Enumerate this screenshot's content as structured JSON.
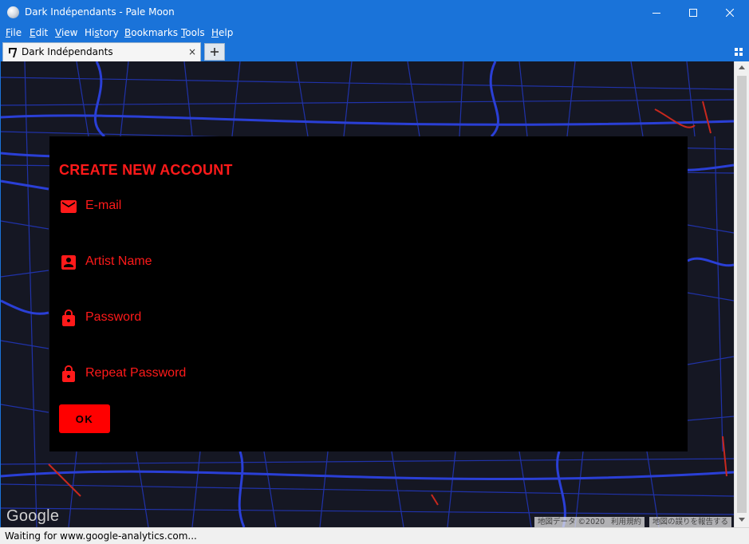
{
  "window": {
    "title": "Dark Indépendants - Pale Moon"
  },
  "menubar": {
    "items": [
      {
        "label": "File",
        "accel": "F",
        "rest": "ile"
      },
      {
        "label": "Edit",
        "accel": "E",
        "rest": "dit"
      },
      {
        "label": "View",
        "accel": "V",
        "rest": "iew"
      },
      {
        "label": "History",
        "accel": "s",
        "pre": "Hi",
        "rest": "tory"
      },
      {
        "label": "Bookmarks",
        "accel": "B",
        "rest": "ookmarks"
      },
      {
        "label": "Tools",
        "accel": "T",
        "rest": "ools"
      },
      {
        "label": "Help",
        "accel": "H",
        "rest": "elp"
      }
    ]
  },
  "tabs": [
    {
      "title": "Dark Indépendants",
      "close": "×",
      "active": true
    }
  ],
  "form": {
    "title": "CREATE NEW ACCOUNT",
    "fields": [
      {
        "label": "E-mail",
        "icon": "email-icon"
      },
      {
        "label": "Artist Name",
        "icon": "account-box-icon"
      },
      {
        "label": "Password",
        "icon": "lock-icon"
      },
      {
        "label": "Repeat Password",
        "icon": "lock-icon"
      }
    ],
    "submit_label": "OK"
  },
  "map": {
    "logo": "Google",
    "attribution": [
      "地図データ ©2020",
      "利用規約",
      "地図の誤りを報告する"
    ]
  },
  "colors": {
    "accent": "#ff0000",
    "chrome": "#1a73d9",
    "panel": "#000000",
    "map_roads": "#2a3fd6",
    "map_bg": "#151723"
  },
  "statusbar": {
    "text": "Waiting for www.google-analytics.com..."
  }
}
